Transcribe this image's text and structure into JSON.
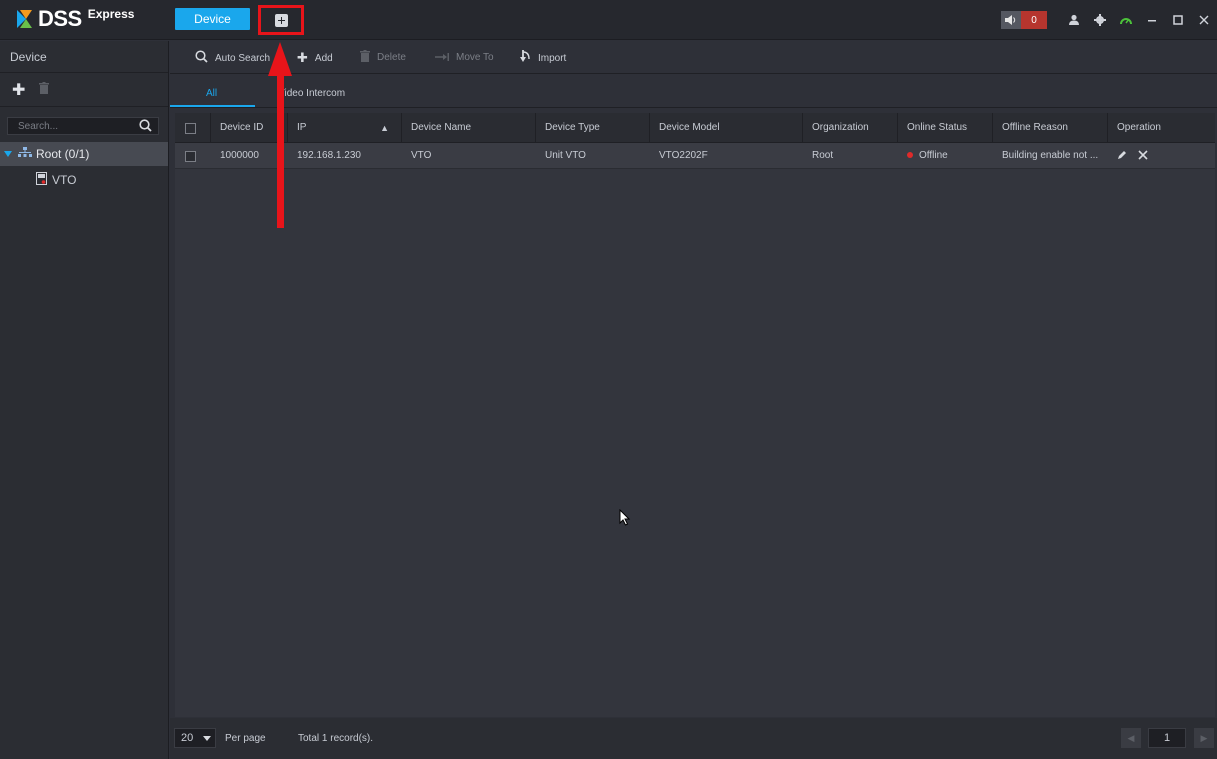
{
  "app": {
    "name": "DSS",
    "edition": "Express"
  },
  "top_tabs": {
    "device_label": "Device",
    "add_tab_icon": "plus-square-icon"
  },
  "alarm": {
    "count": "0"
  },
  "sys_icons": [
    "user-icon",
    "gear-icon",
    "gauge-icon",
    "minimize-icon",
    "maximize-icon",
    "close-icon"
  ],
  "left_panel": {
    "title": "Device",
    "search_placeholder": "Search...",
    "tree": {
      "root_label": "Root (0/1)",
      "children": [
        "VTO"
      ]
    }
  },
  "toolbar": {
    "auto_search": "Auto Search",
    "add": "Add",
    "delete": "Delete",
    "move_to": "Move To",
    "import": "Import"
  },
  "subtabs": {
    "all": "All",
    "video_intercom": "Video Intercom"
  },
  "table": {
    "columns": [
      "Device ID",
      "IP",
      "Device Name",
      "Device Type",
      "Device Model",
      "Organization",
      "Online Status",
      "Offline Reason",
      "Operation"
    ],
    "rows": [
      {
        "device_id": "1000000",
        "ip": "192.168.1.230",
        "device_name": "VTO",
        "device_type": "Unit VTO",
        "device_model": "VTO2202F",
        "organization": "Root",
        "online_status": "Offline",
        "offline_reason": "Building enable not ..."
      }
    ]
  },
  "footer": {
    "per_page_value": "20",
    "per_page_label": "Per page",
    "total": "Total 1 record(s).",
    "current_page": "1"
  },
  "colors": {
    "accent": "#1aa7ec",
    "highlight_box": "#e8141a",
    "offline_dot": "#e02a2a",
    "alarm_badge": "#b6352e"
  }
}
